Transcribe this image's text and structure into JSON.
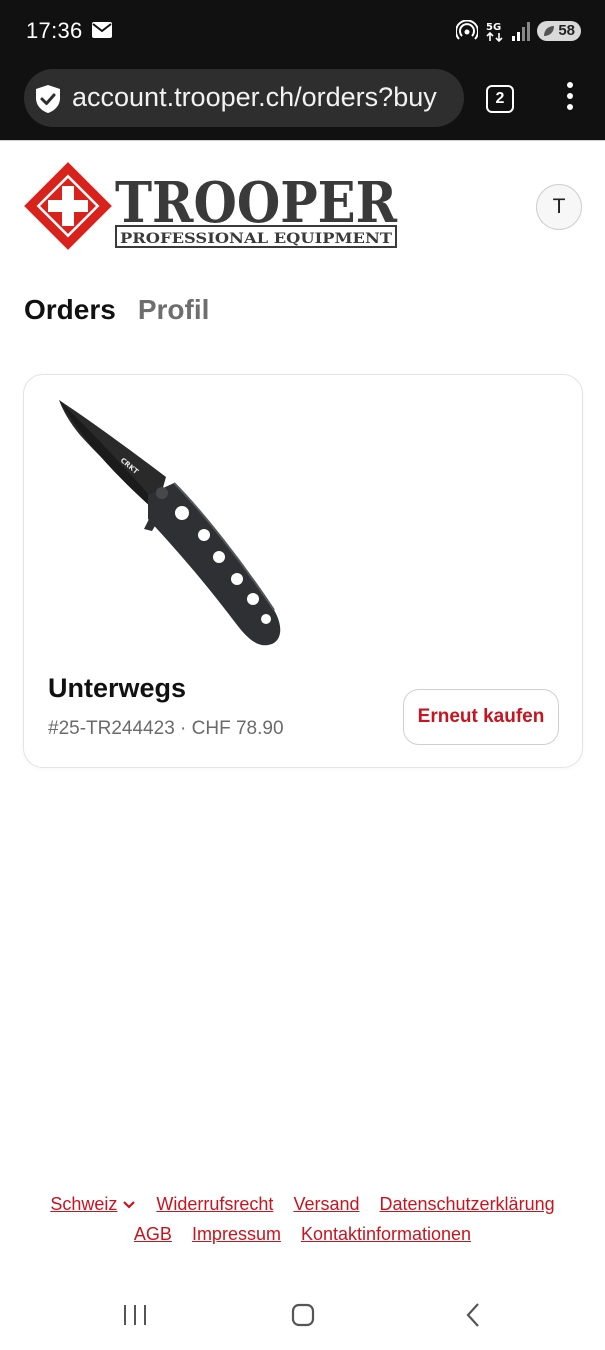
{
  "status_bar": {
    "time": "17:36",
    "network": "5G",
    "battery": "58",
    "icons": [
      "mail-icon",
      "hotspot-icon",
      "5g-icon",
      "signal-icon",
      "battery-icon"
    ]
  },
  "browser": {
    "url": "account.trooper.ch/orders?buy",
    "tab_count": "2",
    "icons": [
      "shield-check-icon",
      "tabs-icon",
      "more-vert-icon"
    ]
  },
  "header": {
    "logo_title": "TROOPER",
    "logo_subtitle": "PROFESSIONAL EQUIPMENT",
    "avatar_initial": "T"
  },
  "tabs": [
    {
      "label": "Orders",
      "active": true
    },
    {
      "label": "Profil",
      "active": false
    }
  ],
  "order": {
    "title": "Unterwegs",
    "number": "#25-TR244423",
    "separator": "·",
    "total": "CHF 78.90",
    "rebuy_label": "Erneut kaufen",
    "product_brand_mark": "CRKT"
  },
  "footer": {
    "row1": [
      "Schweiz",
      "Widerrufsrecht",
      "Versand",
      "Datenschutzerklärung"
    ],
    "row2": [
      "AGB",
      "Impressum",
      "Kontaktinformationen"
    ]
  },
  "colors": {
    "accent": "#c8141e",
    "statusbar_bg": "#111111",
    "url_pill_bg": "#2e2e2e",
    "inactive_tab": "#6e6e6e"
  }
}
